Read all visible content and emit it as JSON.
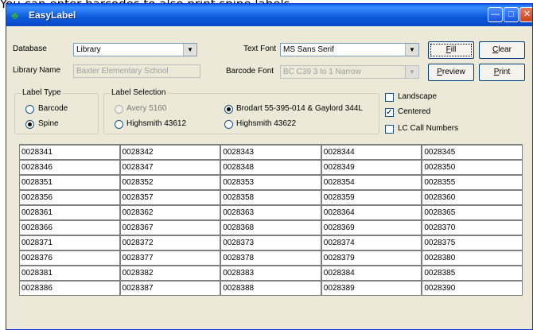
{
  "caption": "You can enter barcodes to also print spine labels.",
  "window": {
    "title": "EasyLabel",
    "icon": "app-icon",
    "controls": [
      "minimize-icon",
      "maximize-icon",
      "close-icon"
    ]
  },
  "form": {
    "database_label": "Database",
    "database_value": "Library",
    "library_name_label": "Library Name",
    "library_name_value": "Baxter Elementary School",
    "text_font_label": "Text Font",
    "text_font_value": "MS Sans Serif",
    "barcode_font_label": "Barcode Font",
    "barcode_font_value": "BC C39 3 to 1 Narrow"
  },
  "buttons": {
    "fill": {
      "hotkey": "F",
      "rest": "ill"
    },
    "clear": {
      "hotkey": "C",
      "rest": "lear"
    },
    "preview": {
      "hotkey": "P",
      "rest": "review"
    },
    "print": {
      "hotkey": "P",
      "rest": "rint"
    }
  },
  "label_type": {
    "title": "Label Type",
    "options": [
      {
        "label": "Barcode",
        "checked": false
      },
      {
        "label": "Spine",
        "checked": true
      }
    ]
  },
  "label_selection": {
    "title": "Label Selection",
    "options": [
      {
        "label": "Avery 5160",
        "checked": false,
        "disabled": true
      },
      {
        "label": "Highsmith 43612",
        "checked": false,
        "disabled": false
      },
      {
        "label": "Brodart 55-395-014 & Gaylord 344L",
        "checked": true,
        "disabled": false
      },
      {
        "label": "Highsmith 43622",
        "checked": false,
        "disabled": false
      }
    ]
  },
  "options": {
    "landscape": {
      "label": "Landscape",
      "checked": false
    },
    "centered": {
      "label": "Centered",
      "checked": true
    },
    "lc_call_numbers": {
      "label": "LC Call Numbers",
      "checked": false
    }
  },
  "grid": [
    [
      "0028341",
      "0028342",
      "0028343",
      "0028344",
      "0028345"
    ],
    [
      "0028346",
      "0028347",
      "0028348",
      "0028349",
      "0028350"
    ],
    [
      "0028351",
      "0028352",
      "0028353",
      "0028354",
      "0028355"
    ],
    [
      "0028356",
      "0028357",
      "0028358",
      "0028359",
      "0028360"
    ],
    [
      "0028361",
      "0028362",
      "0028363",
      "0028364",
      "0028365"
    ],
    [
      "0028366",
      "0028367",
      "0028368",
      "0028369",
      "0028370"
    ],
    [
      "0028371",
      "0028372",
      "0028373",
      "0028374",
      "0028375"
    ],
    [
      "0028376",
      "0028377",
      "0028378",
      "0028379",
      "0028380"
    ],
    [
      "0028381",
      "0028382",
      "0028383",
      "0028384",
      "0028385"
    ],
    [
      "0028386",
      "0028387",
      "0028388",
      "0028389",
      "0028390"
    ]
  ]
}
